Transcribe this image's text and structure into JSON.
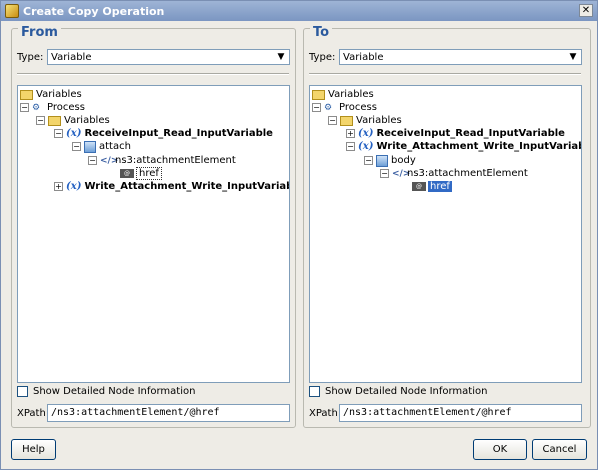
{
  "window": {
    "title": "Create Copy Operation",
    "close_glyph": "✕"
  },
  "from_panel": {
    "heading": "From",
    "type_label": "Type:",
    "type_value": "Variable",
    "tree": {
      "root": "Variables",
      "process": "Process",
      "variables": "Variables",
      "var1": "ReceiveInput_Read_InputVariable",
      "part": "attach",
      "element": "ns3:attachmentElement",
      "attribute": "href",
      "var2": "Write_Attachment_Write_InputVariable"
    },
    "checkbox_label": "Show Detailed Node Information",
    "xpath_label": "XPath:",
    "xpath_value": "/ns3:attachmentElement/@href"
  },
  "to_panel": {
    "heading": "To",
    "type_label": "Type:",
    "type_value": "Variable",
    "tree": {
      "root": "Variables",
      "process": "Process",
      "variables": "Variables",
      "var1": "ReceiveInput_Read_InputVariable",
      "var2": "Write_Attachment_Write_InputVariable",
      "part": "body",
      "element": "ns3:attachmentElement",
      "attribute": "href"
    },
    "checkbox_label": "Show Detailed Node Information",
    "xpath_label": "XPath:",
    "xpath_value": "/ns3:attachmentElement/@href"
  },
  "buttons": {
    "help": "Help",
    "ok": "OK",
    "cancel": "Cancel"
  },
  "icons": {
    "folder": "folder-icon",
    "process": "process-icon",
    "variable": "variable-icon",
    "message_part": "message-part-icon",
    "element": "element-icon",
    "attribute": "attribute-icon"
  },
  "colors": {
    "heading": "#2b5a9e",
    "selection": "#316ac5",
    "titlebar": "#7b96c2"
  }
}
